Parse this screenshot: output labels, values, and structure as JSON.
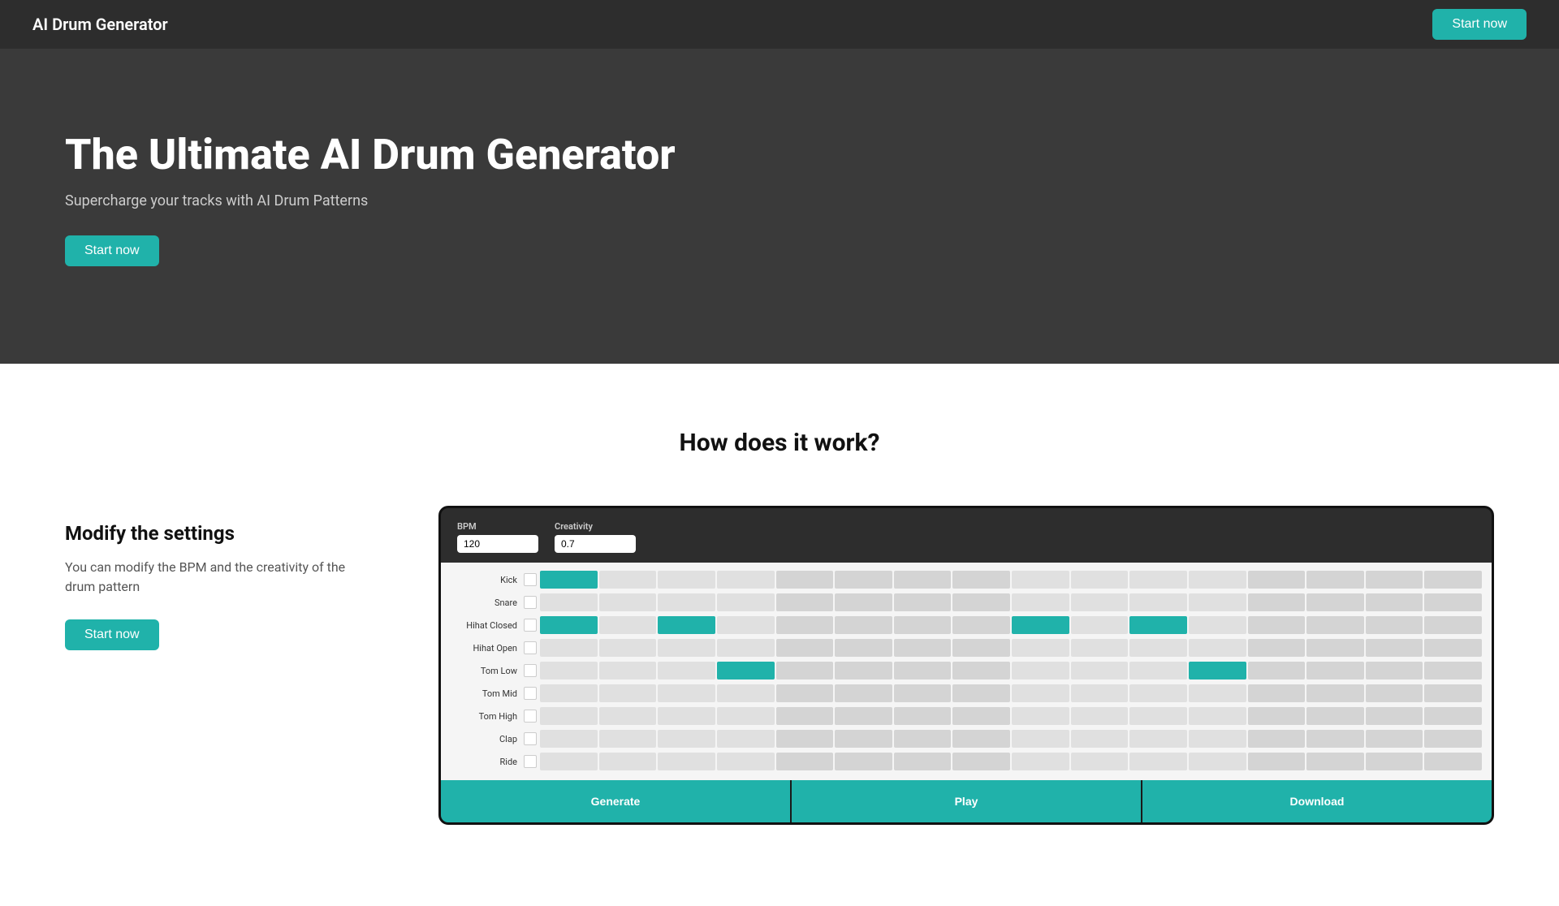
{
  "nav": {
    "logo": "AI Drum Generator",
    "cta_label": "Start now"
  },
  "hero": {
    "title": "The Ultimate AI Drum Generator",
    "subtitle": "Supercharge your tracks with AI Drum Patterns",
    "cta_label": "Start now"
  },
  "how_section": {
    "heading": "How does it work?",
    "step1": {
      "title": "Modify the settings",
      "description": "You can modify the BPM and the creativity of the drum pattern",
      "cta_label": "Start now"
    }
  },
  "drum_mockup": {
    "bpm_label": "BPM",
    "bpm_value": "120",
    "creativity_label": "Creativity",
    "creativity_value": "0.7",
    "instruments": [
      "Kick",
      "Snare",
      "Hihat Closed",
      "Hihat Open",
      "Tom Low",
      "Tom Mid",
      "Tom High",
      "Clap",
      "Ride"
    ],
    "generate_label": "Generate",
    "play_label": "Play",
    "download_label": "Download"
  },
  "colors": {
    "teal": "#20b2aa",
    "nav_bg": "#2d2d2d",
    "hero_bg": "#3a3a3a"
  }
}
